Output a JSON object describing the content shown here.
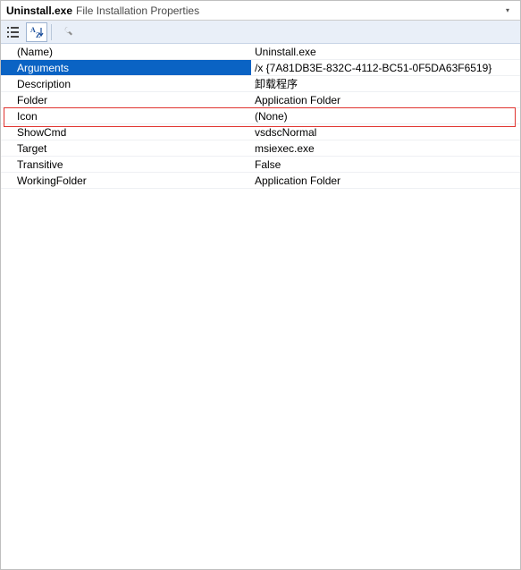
{
  "title": {
    "object": "Uninstall.exe",
    "label": "File Installation Properties"
  },
  "toolbar": {
    "categorized_tip": "Categorized",
    "alphabetical_tip": "Alphabetical",
    "properties_tip": "Property Pages"
  },
  "properties": [
    {
      "name": "(Name)",
      "value": "Uninstall.exe",
      "selected": false
    },
    {
      "name": "Arguments",
      "value": "/x {7A81DB3E-832C-4112-BC51-0F5DA63F6519}",
      "selected": true,
      "editing": true
    },
    {
      "name": "Description",
      "value": "卸载程序",
      "selected": false
    },
    {
      "name": "Folder",
      "value": "Application Folder",
      "selected": false
    },
    {
      "name": "Icon",
      "value": "(None)",
      "selected": false
    },
    {
      "name": "ShowCmd",
      "value": "vsdscNormal",
      "selected": false
    },
    {
      "name": "Target",
      "value": "msiexec.exe",
      "selected": false
    },
    {
      "name": "Transitive",
      "value": "False",
      "selected": false
    },
    {
      "name": "WorkingFolder",
      "value": "Application Folder",
      "selected": false
    }
  ]
}
